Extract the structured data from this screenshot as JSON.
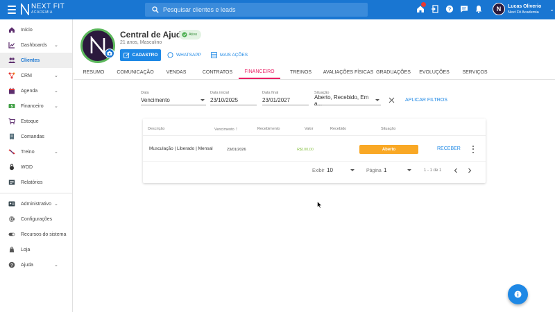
{
  "app": {
    "logo_title": "NEXT FIT",
    "logo_sub": "ACADEMIA"
  },
  "search": {
    "placeholder": "Pesquisar clientes e leads"
  },
  "user": {
    "name": "Lucas Oliverio",
    "company": "Next Fit Academia",
    "initial": "N"
  },
  "top_icons": [
    "home-icon",
    "door-exit-icon",
    "help-icon",
    "chat-icon",
    "bell-icon"
  ],
  "sidebar": {
    "items": [
      {
        "label": "Início",
        "icon": "home-icon",
        "chevron": false
      },
      {
        "label": "Dashboards",
        "icon": "chart-line-icon",
        "chevron": true
      },
      {
        "label": "Clientes",
        "icon": "people-icon",
        "chevron": false,
        "active": true
      },
      {
        "label": "CRM",
        "icon": "crm-icon",
        "chevron": true
      },
      {
        "label": "Agenda",
        "icon": "calendar-icon",
        "chevron": true
      },
      {
        "label": "Financeiro",
        "icon": "money-icon",
        "chevron": true
      },
      {
        "label": "Estoque",
        "icon": "cart-icon",
        "chevron": false
      },
      {
        "label": "Comandas",
        "icon": "receipt-icon",
        "chevron": false
      },
      {
        "label": "Treino",
        "icon": "dumbbell-icon",
        "chevron": true
      },
      {
        "label": "WOD",
        "icon": "kettlebell-icon",
        "chevron": false
      },
      {
        "label": "Relatórios",
        "icon": "report-icon",
        "chevron": false
      },
      {
        "label": "Administrativo",
        "icon": "admin-card-icon",
        "chevron": true
      },
      {
        "label": "Configurações",
        "icon": "gear-icon",
        "chevron": false
      },
      {
        "label": "Recursos do sistema",
        "icon": "toggle-icon",
        "chevron": false
      },
      {
        "label": "Loja",
        "icon": "store-icon",
        "chevron": false
      },
      {
        "label": "Ajuda",
        "icon": "help-icon",
        "chevron": true
      }
    ]
  },
  "profile": {
    "name": "Central de Ajuda",
    "status": "Ativo",
    "subtitle": "21 anos, Masculino",
    "btn_cadastro": "CADASTRO",
    "btn_whatsapp": "WHATSAPP",
    "btn_more": "MAIS AÇÕES"
  },
  "tabs": [
    "RESUMO",
    "COMUNICAÇÃO",
    "VENDAS",
    "CONTRATOS",
    "FINANCEIRO",
    "TREINOS",
    "AVALIAÇÕES FÍSICAS",
    "GRADUAÇÕES",
    "EVOLUÇÕES",
    "SERVIÇOS"
  ],
  "active_tab": "FINANCEIRO",
  "filters": {
    "data": {
      "label": "Data",
      "value": "Vencimento"
    },
    "data_inicial": {
      "label": "Data inicial",
      "value": "23/10/2025"
    },
    "data_final": {
      "label": "Data final",
      "value": "23/01/2027"
    },
    "situacao": {
      "label": "Situação",
      "value": "Aberto, Recebido, Em a..."
    },
    "apply_label": "APLICAR FILTROS"
  },
  "table": {
    "headers": {
      "descricao": "Descrição",
      "vencimento": "Vencimento",
      "recebimento": "Recebimento",
      "valor": "Valor",
      "recebido": "Recebido",
      "situacao": "Situação"
    },
    "rows": [
      {
        "descricao": "Musculação | Liberado | Mensal",
        "vencimento": "23/01/2026",
        "recebimento": "",
        "valor": "R$100,00",
        "recebido": "",
        "situacao": "Aberto",
        "action": "RECEBER"
      }
    ]
  },
  "pager": {
    "exibir_label": "Exibir",
    "exibir_value": "10",
    "pagina_label": "Página",
    "pagina_value": "1",
    "range": "1 - 1 de 1"
  },
  "colors": {
    "primary": "#1976d2",
    "accent_tab": "#e91e63",
    "status_open": "#f9a825",
    "value_green": "#8bc34a"
  }
}
